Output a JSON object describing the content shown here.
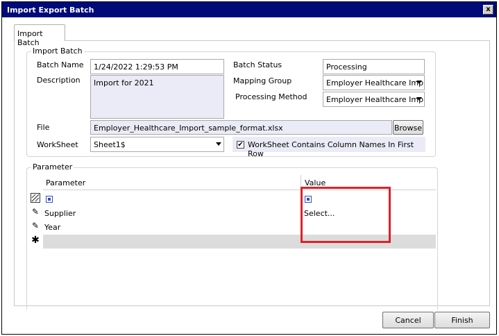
{
  "window": {
    "title": "Import Export Batch",
    "close_glyph": "x"
  },
  "tab": {
    "label": "Import Batch"
  },
  "import_batch": {
    "group_title": "Import Batch",
    "batch_name_label": "Batch Name",
    "batch_name_value": "1/24/2022 1:29:53 PM",
    "description_label": "Description",
    "description_value": "Import for 2021",
    "batch_status_label": "Batch Status",
    "batch_status_value": "Processing",
    "mapping_group_label": "Mapping Group",
    "mapping_group_value": "Employer Healthcare Imp",
    "processing_method_label": "Processing Method",
    "processing_method_value": "Employer Healthcare Imp",
    "file_label": "File",
    "file_value": "Employer_Healthcare_Import_sample_format.xlsx",
    "browse_label": "Browse",
    "worksheet_label": "WorkSheet",
    "worksheet_value": "Sheet1$",
    "column_names_label": "WorkSheet Contains Column Names In First Row",
    "column_names_checked": true
  },
  "parameter": {
    "group_title": "Parameter",
    "columns": [
      "Parameter",
      "Value"
    ],
    "rows": [
      {
        "indicator": "filter-icon",
        "parameter": "",
        "value": ""
      },
      {
        "indicator": "pencil-icon",
        "parameter": "Supplier",
        "value": "Select..."
      },
      {
        "indicator": "pencil-icon",
        "parameter": "Year",
        "value": ""
      },
      {
        "indicator": "new-row-icon",
        "parameter": "",
        "value": ""
      }
    ]
  },
  "footer": {
    "cancel_label": "Cancel",
    "finish_label": "Finish"
  },
  "colors": {
    "titlebar": "#000a78",
    "highlight": "#e0202a",
    "readonly_field": "#ebebf7",
    "new_row": "#dcdcdc"
  }
}
